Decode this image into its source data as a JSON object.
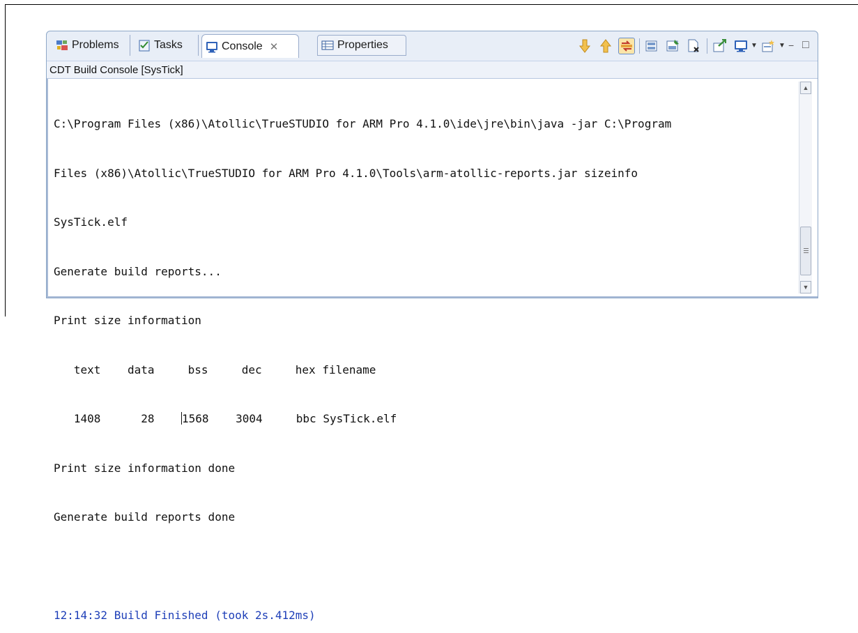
{
  "tabs": [
    {
      "label": "Problems",
      "icon": "problems-icon",
      "active": false
    },
    {
      "label": "Tasks",
      "icon": "tasks-icon",
      "active": false
    },
    {
      "label": "Console",
      "icon": "console-icon",
      "active": true,
      "close": "✕"
    },
    {
      "label": "Properties",
      "icon": "properties-icon",
      "active": false
    }
  ],
  "toolbar": {
    "buttons": [
      "scroll-down-icon",
      "scroll-up-icon",
      "scroll-lock-icon",
      "clear-console-icon",
      "pin-console-icon",
      "word-wrap-icon",
      "terminate-icon",
      "open-console-icon",
      "display-selected-console-icon",
      "new-console-icon"
    ],
    "view_controls": {
      "minimize": "−",
      "maximize": "□"
    }
  },
  "console": {
    "title": "CDT Build Console [SysTick]",
    "lines": [
      "C:\\Program Files (x86)\\Atollic\\TrueSTUDIO for ARM Pro 4.1.0\\ide\\jre\\bin\\java -jar C:\\Program",
      "Files (x86)\\Atollic\\TrueSTUDIO for ARM Pro 4.1.0\\Tools\\arm-atollic-reports.jar sizeinfo",
      "SysTick.elf",
      "Generate build reports...",
      "Print size information",
      "   text    data     bss     dec     hex filename",
      "   1408      28    ",
      "Print size information done",
      "Generate build reports done",
      "",
      "12:14:32 Build Finished (took 2s.412ms)"
    ],
    "size_row_after_caret": "1568    3004     bbc SysTick.elf"
  },
  "colors": {
    "finished_text": "#1e3fb8",
    "view_border": "#8ea8c8",
    "tab_background": "#e8eef7"
  }
}
